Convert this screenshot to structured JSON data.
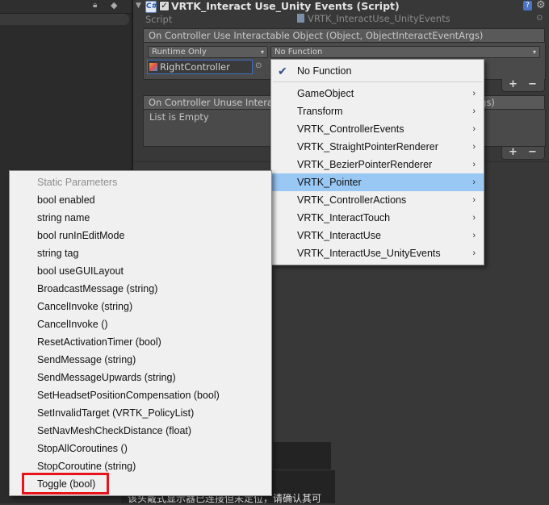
{
  "inspector": {
    "component_title": "VRTK_Interact Use_Unity Events (Script)",
    "enabled_check": "✓",
    "fold_arrow": "▼",
    "script_badge": "C#",
    "help_glyph": "?",
    "gear_glyph": "⚙",
    "script_label": "Script",
    "script_value": "VRTK_InteractUse_UnityEvents",
    "target_glyph": "⊙"
  },
  "event_use": {
    "title": "On Controller Use Interactable Object (Object, ObjectInteractEventArgs)",
    "runtime_mode": "Runtime Only",
    "function": "No Function",
    "object": "RightController",
    "picker_glyph": "⊙",
    "plus": "+",
    "minus": "−",
    "arrow": "▾"
  },
  "event_unuse": {
    "title": "On Controller Unuse Interactable Object (Object, ObjectInteractEventArgs)",
    "list_text": "List is Empty",
    "plus": "+",
    "minus": "−"
  },
  "bottom_popup": {
    "text": "该头戴式显示器已连接但未定位，请确认其可"
  },
  "function_menu": {
    "check_glyph": "✔",
    "submenu_glyph": "›",
    "items": [
      {
        "label": "No Function",
        "checked": true
      },
      {
        "label": "GameObject",
        "submenu": true
      },
      {
        "label": "Transform",
        "submenu": true
      },
      {
        "label": "VRTK_ControllerEvents",
        "submenu": true
      },
      {
        "label": "VRTK_StraightPointerRenderer",
        "submenu": true
      },
      {
        "label": "VRTK_BezierPointerRenderer",
        "submenu": true
      },
      {
        "label": "VRTK_Pointer",
        "submenu": true,
        "highlighted": true
      },
      {
        "label": "VRTK_ControllerActions",
        "submenu": true
      },
      {
        "label": "VRTK_InteractTouch",
        "submenu": true
      },
      {
        "label": "VRTK_InteractUse",
        "submenu": true
      },
      {
        "label": "VRTK_InteractUse_UnityEvents",
        "submenu": true
      }
    ]
  },
  "member_menu": {
    "items": [
      "Static Parameters",
      "bool enabled",
      "string name",
      "bool runInEditMode",
      "string tag",
      "bool useGUILayout",
      "BroadcastMessage (string)",
      "CancelInvoke (string)",
      "CancelInvoke ()",
      "ResetActivationTimer (bool)",
      "SendMessage (string)",
      "SendMessageUpwards (string)",
      "SetHeadsetPositionCompensation (bool)",
      "SetInvalidTarget (VRTK_PolicyList)",
      "SetNavMeshCheckDistance (float)",
      "StopAllCoroutines ()",
      "StopCoroutine (string)",
      "Toggle (bool)"
    ]
  },
  "colors": {
    "highlight": "#99c8f5",
    "annotation": "#e8141b",
    "object_field_border": "#3c6fc4"
  }
}
